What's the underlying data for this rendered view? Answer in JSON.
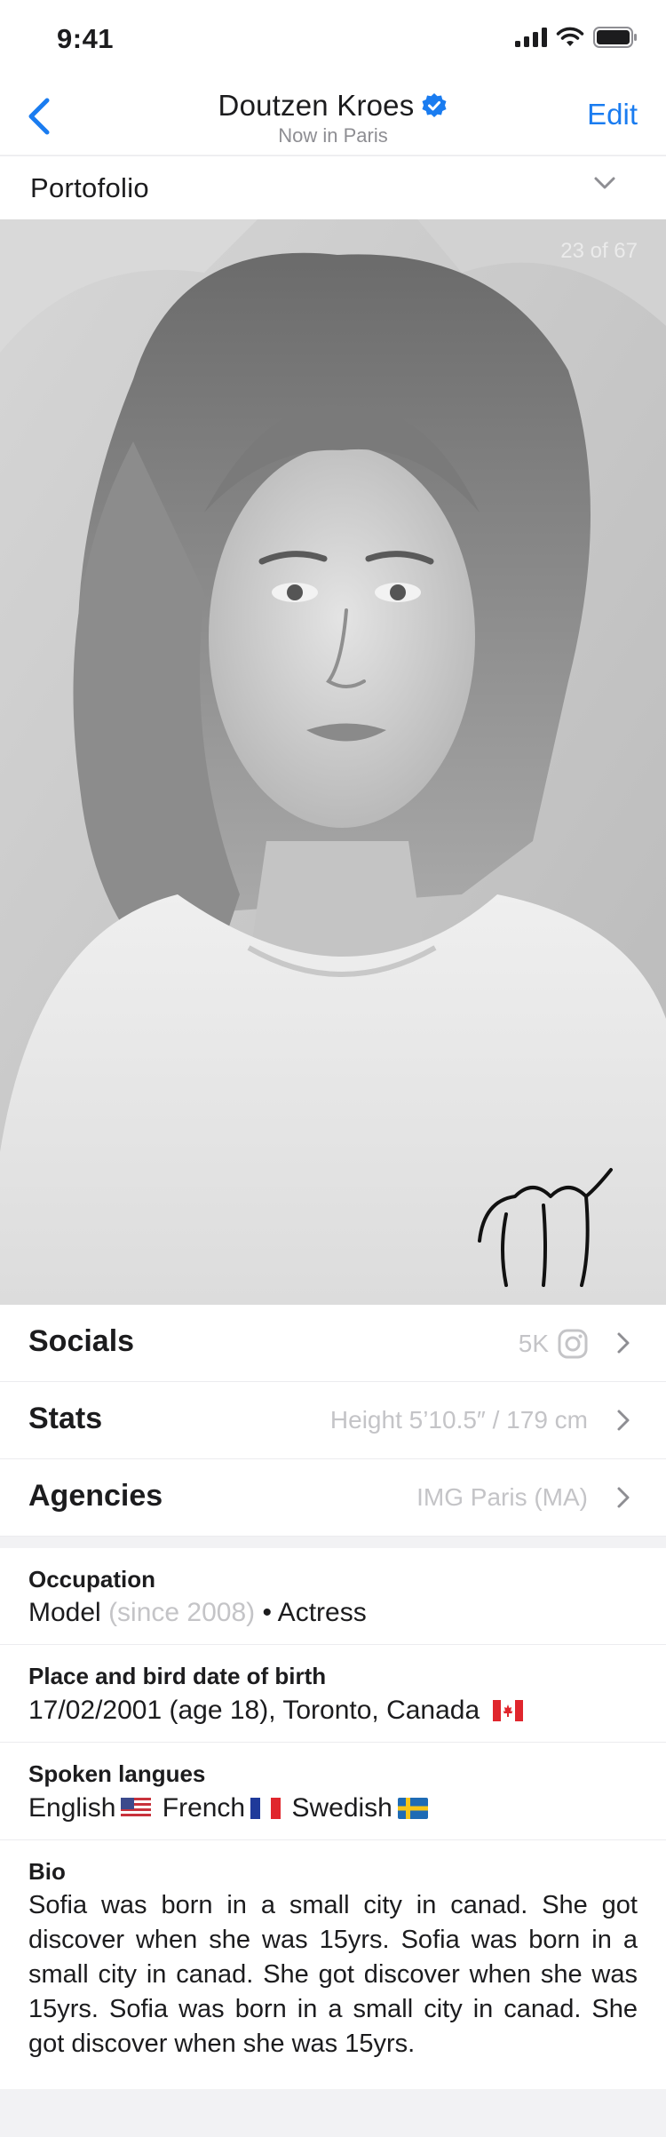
{
  "status": {
    "time": "9:41"
  },
  "nav": {
    "name": "Doutzen Kroes",
    "location": "Now in Paris",
    "edit_label": "Edit"
  },
  "portfolio": {
    "label": "Portofolio",
    "counter": "23 of 67"
  },
  "rows": {
    "socials": {
      "label": "Socials",
      "value": "5K",
      "icon": "instagram-icon"
    },
    "stats": {
      "label": "Stats",
      "value": "Height 5’10.5″ / 179 cm"
    },
    "agencies": {
      "label": "Agencies",
      "value": "IMG Paris (MA)"
    }
  },
  "info": {
    "occupation": {
      "title": "Occupation",
      "primary": "Model",
      "since": "(since 2008)",
      "secondary": "• Actress"
    },
    "birth": {
      "title": "Place and bird date of birth",
      "text": "17/02/2001 (age 18), Toronto, Canada",
      "flag": "canada-flag"
    },
    "languages": {
      "title": "Spoken langues",
      "items": [
        {
          "name": "English",
          "flag": "usa-flag"
        },
        {
          "name": "French",
          "flag": "france-flag"
        },
        {
          "name": "Swedish",
          "flag": "sweden-flag"
        }
      ]
    },
    "bio": {
      "title": "Bio",
      "text": "Sofia was born in a small city in canad. She got discover when she was 15yrs. Sofia was born in a small city in canad. She got discover when she was 15yrs. Sofia was born in a small city in canad. She got discover when she was 15yrs."
    }
  },
  "colors": {
    "accent": "#1a7cf0",
    "muted": "#c4c4c7",
    "background": "#f2f2f4"
  }
}
